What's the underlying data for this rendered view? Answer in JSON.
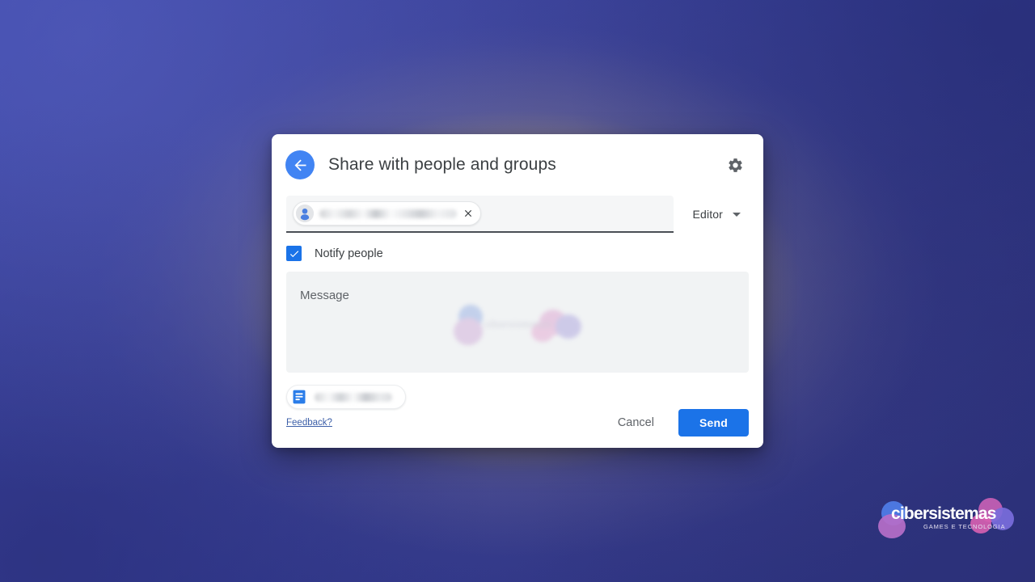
{
  "dialog": {
    "title": "Share with people and groups",
    "back_icon": "arrow-left-icon",
    "settings_icon": "gear-icon",
    "recipient": {
      "avatar_icon": "person-icon",
      "chip_text": "",
      "remove_icon": "close-icon",
      "role": "Editor",
      "role_caret_icon": "chevron-down-icon"
    },
    "notify": {
      "checked": true,
      "label": "Notify people",
      "check_icon": "checkmark-icon"
    },
    "message": {
      "placeholder": "Message",
      "value": ""
    },
    "file": {
      "icon": "google-docs-icon",
      "name": ""
    },
    "footer": {
      "feedback_label": "Feedback?",
      "cancel_label": "Cancel",
      "send_label": "Send"
    }
  },
  "watermark": {
    "title": "cibersistemas",
    "subtitle": "GAMES E TECNOLOGIA"
  },
  "colors": {
    "accent_blue": "#1b73e8",
    "back_button_blue": "#4184f3",
    "text_primary": "#3c4043",
    "text_secondary": "#5f6368",
    "message_bg": "#f1f3f4",
    "field_bg": "#f5f6f7",
    "background_blue": "#3b44a4",
    "glow_gold": "#d6bc78"
  }
}
